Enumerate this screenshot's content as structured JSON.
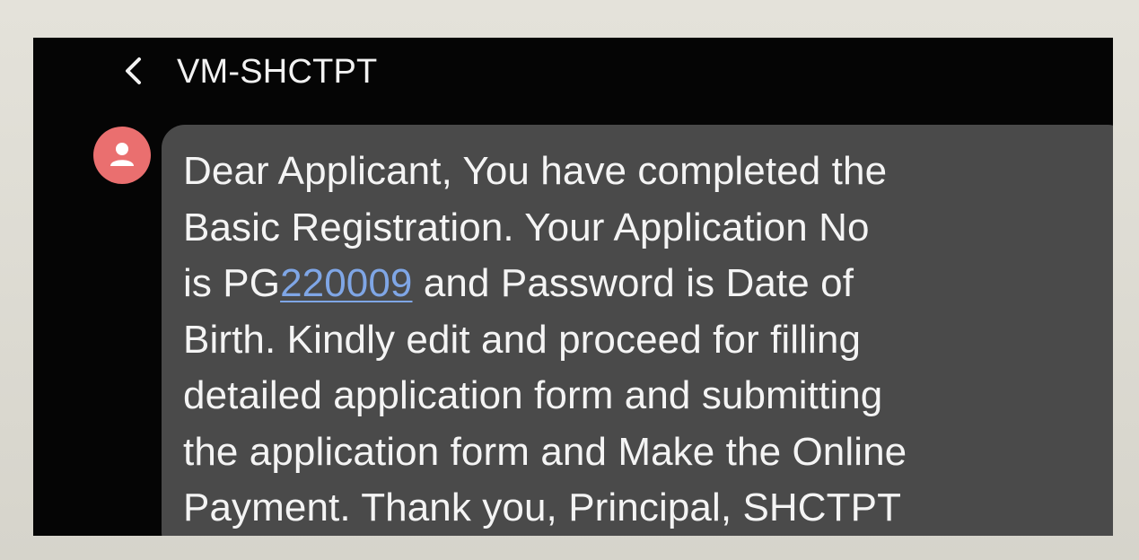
{
  "header": {
    "back_icon": "chevron-left-icon",
    "contact_name": "VM-SHCTPT"
  },
  "thread": {
    "avatar_icon": "person-icon",
    "avatar_color": "#ea6f6f",
    "message": {
      "line1": "Dear Applicant, You have completed the",
      "line2": "Basic Registration. Your Application No",
      "line3_prefix": "is PG",
      "line3_link": "220009",
      "line3_suffix": " and Password is Date of",
      "line4": "Birth. Kindly edit and proceed for filling",
      "line5": "detailed application form and submitting",
      "line6": "the application form and Make the Online",
      "line7": "Payment. Thank you, Principal, SHCTPT"
    }
  },
  "colors": {
    "screen_background": "#050505",
    "bubble_background": "#4a4a4a",
    "message_text": "#f4f4f4",
    "link_text": "#7fa6e6",
    "frame": "#d9d7cf"
  }
}
